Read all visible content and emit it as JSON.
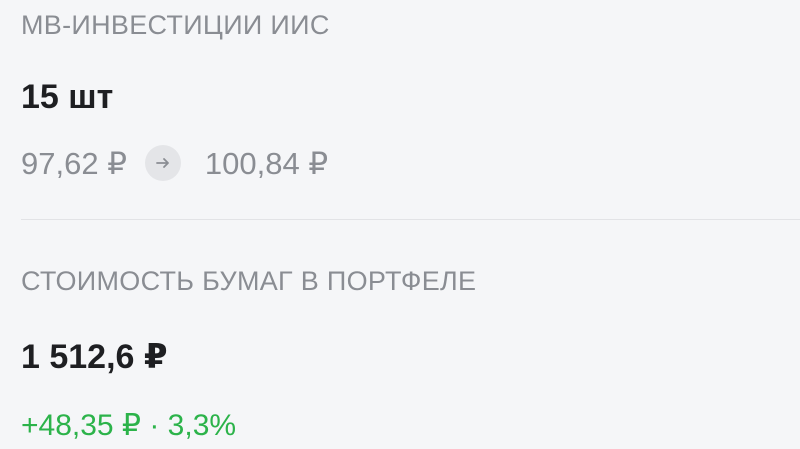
{
  "position": {
    "title": "МВ-ИНВЕСТИЦИИ ИИС",
    "quantity": "15 шт",
    "price_from": "97,62 ₽",
    "price_to": "100,84 ₽",
    "arrow_icon": "arrow-right-icon"
  },
  "portfolio": {
    "title": "СТОИМОСТЬ БУМАГ В ПОРТФЕЛЕ",
    "value": "1 512,6 ₽",
    "change": "+48,35 ₽ · 3,3%"
  },
  "colors": {
    "background": "#f5f6f8",
    "muted_text": "#8a8d93",
    "primary_text": "#1e1f22",
    "positive": "#2cb34a"
  }
}
